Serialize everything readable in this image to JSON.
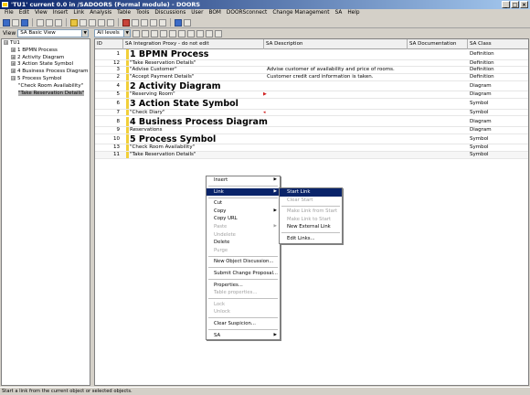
{
  "window": {
    "title": "'TU1' current 0.0 in /SADOORS (Formal module) - DOORS",
    "controls": [
      "_",
      "□",
      "×"
    ]
  },
  "menubar": [
    "File",
    "Edit",
    "View",
    "Insert",
    "Link",
    "Analysis",
    "Table",
    "Tools",
    "Discussions",
    "User",
    "BOM",
    "DOORSconnect",
    "Change Management",
    "SA",
    "Help"
  ],
  "viewbar": {
    "view_label": "View",
    "view_value": "SA Basic View",
    "levels_value": "All levels"
  },
  "tree": [
    {
      "label": "TU1",
      "exp": "⊟",
      "level": 0
    },
    {
      "label": "1 BPMN Process",
      "exp": "⊞",
      "level": 1
    },
    {
      "label": "2 Activity Diagram",
      "exp": "⊞",
      "level": 1
    },
    {
      "label": "3 Action State Symbol",
      "exp": "⊞",
      "level": 1
    },
    {
      "label": "4 Business Process Diagram",
      "exp": "⊞",
      "level": 1
    },
    {
      "label": "5 Process Symbol",
      "exp": "⊟",
      "level": 1
    },
    {
      "label": "\"Check Room Availability\"",
      "exp": "",
      "level": 2
    },
    {
      "label": "\"Take Reservation Details\"",
      "exp": "",
      "level": 2,
      "selected": true
    }
  ],
  "grid": {
    "columns": [
      "ID",
      "SA Integration Proxy - do not edit",
      "SA Description",
      "SA Documentation",
      "SA Class"
    ],
    "rows": [
      {
        "id": "1",
        "main": "1 BPMN Process",
        "heading": true,
        "desc": "",
        "cls": "Definition"
      },
      {
        "id": "12",
        "main": "\"Take Reservation Details\"",
        "heading": false,
        "desc": "",
        "cls": "Definition"
      },
      {
        "id": "3",
        "main": "\"Advise Customer\"",
        "heading": false,
        "desc": "Advise customer of availability and price of rooms.",
        "cls": "Definition"
      },
      {
        "id": "2",
        "main": "\"Accept Payment Details\"",
        "heading": false,
        "desc": "Customer credit card information is taken.",
        "cls": "Definition"
      },
      {
        "id": "4",
        "main": "2 Activity Diagram",
        "heading": true,
        "desc": "",
        "cls": "Diagram"
      },
      {
        "id": "5",
        "main": "\"Reserving Room\"",
        "heading": false,
        "desc": "",
        "cls": "Diagram",
        "mark": "▶"
      },
      {
        "id": "6",
        "main": "3 Action State Symbol",
        "heading": true,
        "desc": "",
        "cls": "Symbol"
      },
      {
        "id": "7",
        "main": "\"Check Diary\"",
        "heading": false,
        "desc": "",
        "cls": "Symbol",
        "mark": "◂"
      },
      {
        "id": "8",
        "main": "4 Business Process Diagram",
        "heading": true,
        "desc": "",
        "cls": "Diagram"
      },
      {
        "id": "9",
        "main": "Reservations",
        "heading": false,
        "desc": "",
        "cls": "Diagram"
      },
      {
        "id": "10",
        "main": "5 Process Symbol",
        "heading": true,
        "desc": "",
        "cls": "Symbol"
      },
      {
        "id": "13",
        "main": "\"Check Room Availability\"",
        "heading": false,
        "desc": "",
        "cls": "Symbol"
      },
      {
        "id": "11",
        "main": "\"Take Reservation Details\"",
        "heading": false,
        "desc": "",
        "cls": "Symbol",
        "selected": true
      }
    ]
  },
  "context_menu": [
    {
      "label": "Insert",
      "sub": true
    },
    {
      "sep": true
    },
    {
      "label": "Link",
      "sub": true,
      "highlight": true
    },
    {
      "sep": true
    },
    {
      "label": "Cut"
    },
    {
      "label": "Copy",
      "sub": true
    },
    {
      "label": "Copy URL"
    },
    {
      "label": "Paste",
      "sub": true,
      "disabled": true
    },
    {
      "label": "Undelete",
      "disabled": true
    },
    {
      "label": "Delete"
    },
    {
      "label": "Purge",
      "disabled": true
    },
    {
      "sep": true
    },
    {
      "label": "New Object Discussion..."
    },
    {
      "sep": true
    },
    {
      "label": "Submit Change Proposal..."
    },
    {
      "sep": true
    },
    {
      "label": "Properties..."
    },
    {
      "label": "Table properties...",
      "disabled": true
    },
    {
      "sep": true
    },
    {
      "label": "Lock",
      "disabled": true
    },
    {
      "label": "Unlock",
      "disabled": true
    },
    {
      "sep": true
    },
    {
      "label": "Clear Suspicion..."
    },
    {
      "sep": true
    },
    {
      "label": "SA",
      "sub": true
    }
  ],
  "link_submenu": [
    {
      "label": "Start Link",
      "highlight": true
    },
    {
      "label": "Clear Start",
      "disabled": true
    },
    {
      "sep": true
    },
    {
      "label": "Make Link from Start",
      "disabled": true
    },
    {
      "label": "Make Link to Start",
      "disabled": true
    },
    {
      "label": "New External Link"
    },
    {
      "sep": true
    },
    {
      "label": "Edit Links..."
    }
  ],
  "status": "Start a link from the current object or selected objects."
}
